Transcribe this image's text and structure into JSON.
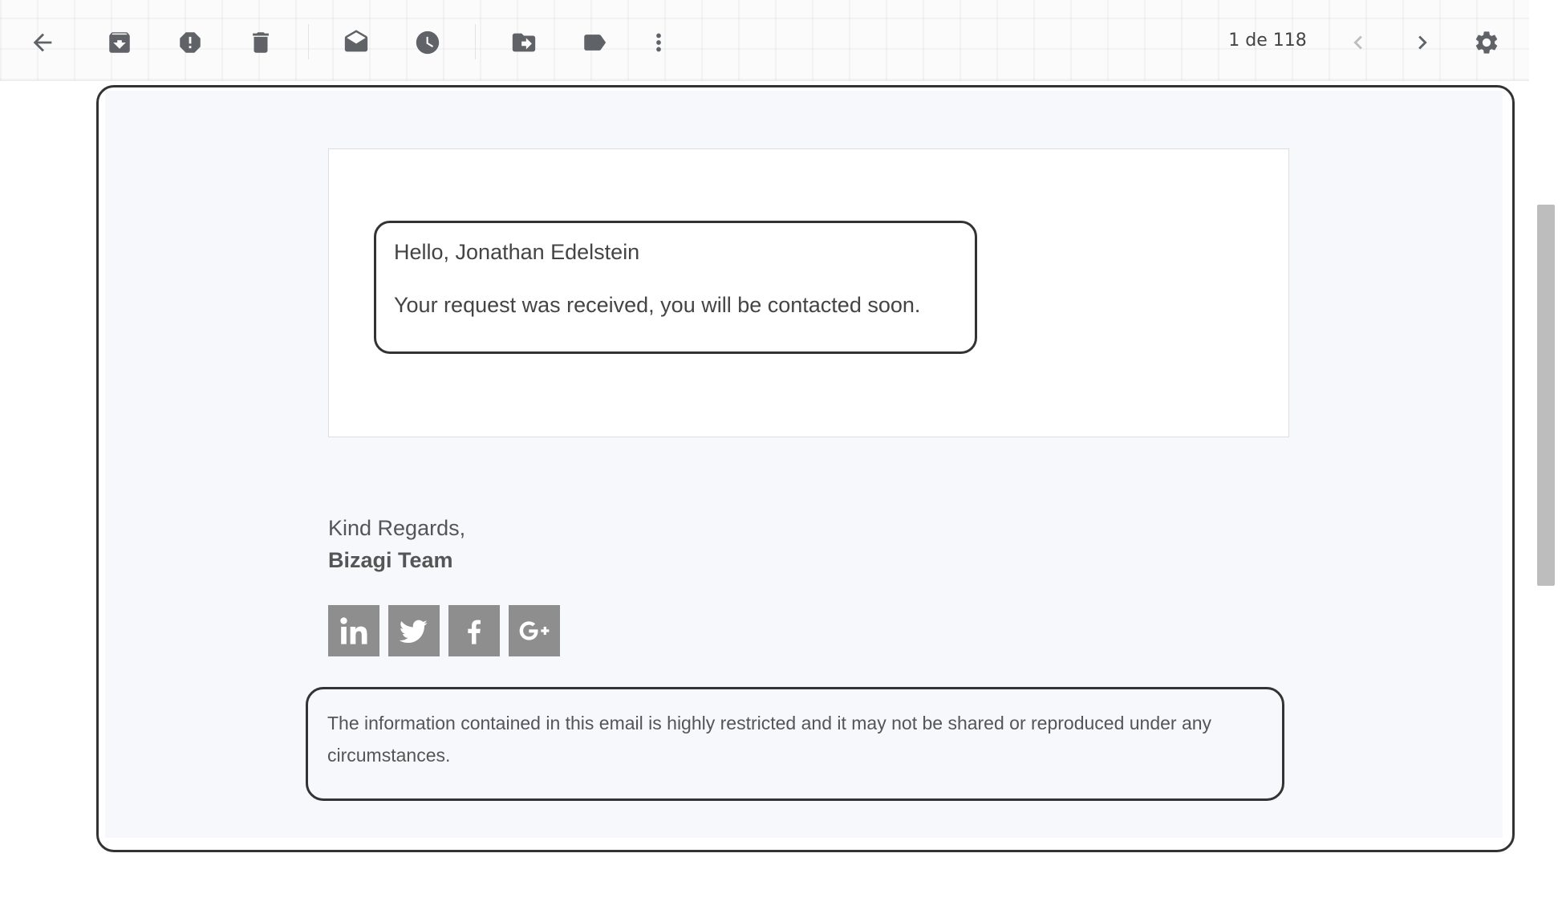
{
  "toolbar": {
    "pager": "1 de 118"
  },
  "email": {
    "greeting": "Hello, Jonathan Edelstein",
    "body": "Your request was received, you will be contacted soon.",
    "regards": "Kind Regards,",
    "team": "Bizagi Team",
    "disclaimer": "The information contained in this email is highly restricted and it may not be shared or reproduced under any circumstances."
  },
  "colors": {
    "icon": "#5f6368",
    "social_bg": "#8e8e8e",
    "email_bg": "#f7f8fc",
    "border": "#333333"
  },
  "icons": {
    "toolbar": [
      "back-arrow-icon",
      "archive-icon",
      "report-spam-icon",
      "delete-icon",
      "mark-unread-icon",
      "snooze-icon",
      "move-to-icon",
      "label-icon",
      "more-vertical-icon",
      "chevron-left-icon",
      "chevron-right-icon",
      "gear-icon"
    ],
    "social": [
      "linkedin-icon",
      "twitter-icon",
      "facebook-icon",
      "google-plus-icon"
    ]
  }
}
